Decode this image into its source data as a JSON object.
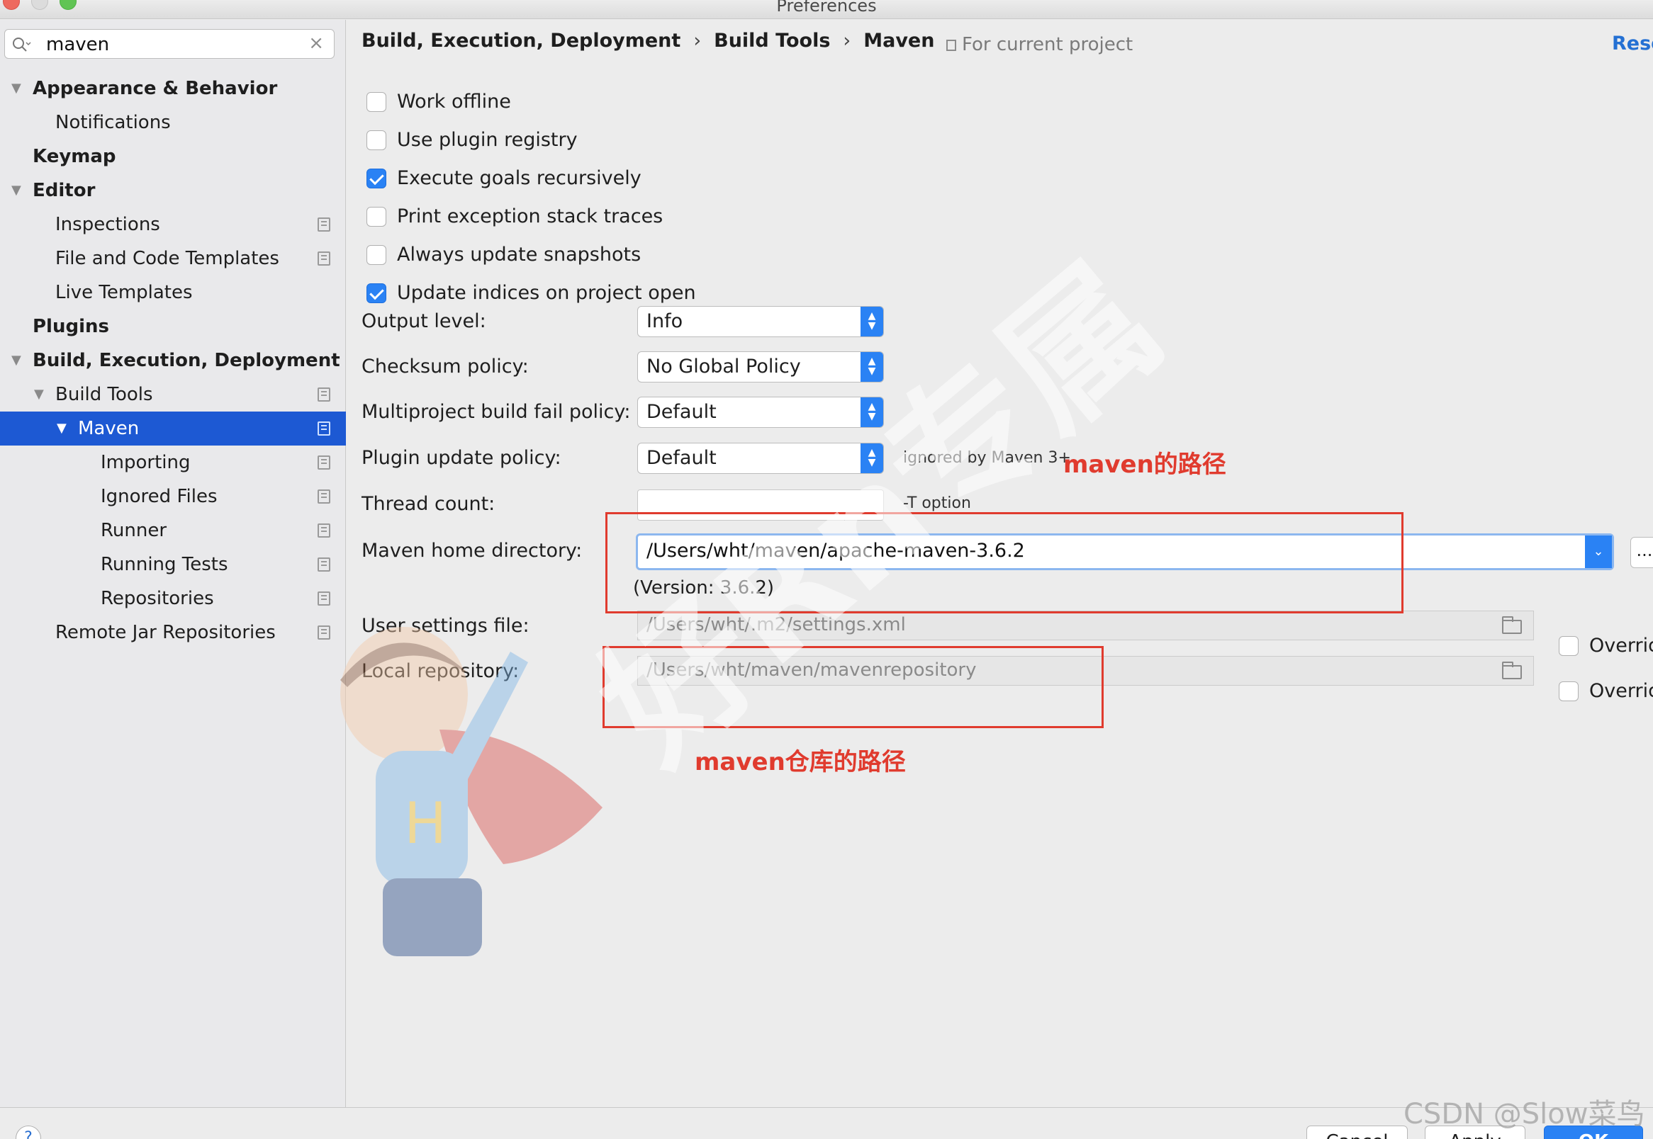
{
  "window": {
    "title": "Preferences"
  },
  "search": {
    "value": "maven",
    "clear_icon": "×"
  },
  "sidebar": {
    "items": [
      {
        "label": "Appearance & Behavior",
        "bold": true,
        "expanded": true,
        "indent": 0
      },
      {
        "label": "Notifications",
        "bold": false,
        "indent": 1
      },
      {
        "label": "Keymap",
        "bold": true,
        "indent": 0
      },
      {
        "label": "Editor",
        "bold": true,
        "expanded": true,
        "indent": 0
      },
      {
        "label": "Inspections",
        "indent": 1,
        "project_icon": true
      },
      {
        "label": "File and Code Templates",
        "indent": 1,
        "project_icon": true
      },
      {
        "label": "Live Templates",
        "indent": 1
      },
      {
        "label": "Plugins",
        "bold": true,
        "indent": 0
      },
      {
        "label": "Build, Execution, Deployment",
        "bold": true,
        "expanded": true,
        "indent": 0
      },
      {
        "label": "Build Tools",
        "indent": 1,
        "expanded": true,
        "project_icon": true
      },
      {
        "label": "Maven",
        "indent": 2,
        "expanded": true,
        "selected": true,
        "project_icon": true
      },
      {
        "label": "Importing",
        "indent": 3,
        "project_icon": true
      },
      {
        "label": "Ignored Files",
        "indent": 3,
        "project_icon": true
      },
      {
        "label": "Runner",
        "indent": 3,
        "project_icon": true
      },
      {
        "label": "Running Tests",
        "indent": 3,
        "project_icon": true
      },
      {
        "label": "Repositories",
        "indent": 3,
        "project_icon": true
      },
      {
        "label": "Remote Jar Repositories",
        "indent": 1,
        "project_icon": true
      }
    ]
  },
  "header": {
    "breadcrumb": [
      "Build, Execution, Deployment",
      "Build Tools",
      "Maven"
    ],
    "separator": "›",
    "for_project": "For current project",
    "reset": "Rese"
  },
  "options": [
    {
      "label": "Work offline",
      "checked": false
    },
    {
      "label": "Use plugin registry",
      "checked": false
    },
    {
      "label": "Execute goals recursively",
      "checked": true
    },
    {
      "label": "Print exception stack traces",
      "checked": false
    },
    {
      "label": "Always update snapshots",
      "checked": false
    },
    {
      "label": "Update indices on project open",
      "checked": true
    }
  ],
  "form": {
    "output_level": {
      "label": "Output level:",
      "value": "Info"
    },
    "checksum_policy": {
      "label": "Checksum policy:",
      "value": "No Global Policy"
    },
    "multiproject_policy": {
      "label": "Multiproject build fail policy:",
      "value": "Default"
    },
    "plugin_update_policy": {
      "label": "Plugin update policy:",
      "value": "Default",
      "note": "ignored by Maven 3+"
    },
    "thread_count": {
      "label": "Thread count:",
      "value": "",
      "note": "-T option"
    },
    "maven_home": {
      "label": "Maven home directory:",
      "value": "/Users/wht/maven/apache-maven-3.6.2",
      "version": "(Version: 3.6.2)",
      "browse": "..."
    },
    "user_settings": {
      "label": "User settings file:",
      "value": "/Users/wht/.m2/settings.xml",
      "override": "Overrid"
    },
    "local_repo": {
      "label": "Local repository:",
      "value": "/Users/wht/maven/mavenrepository",
      "override": "Overrid"
    }
  },
  "annotations": {
    "maven_path": "maven的路径",
    "repo_path": "maven仓库的路径"
  },
  "footer": {
    "help": "?",
    "cancel": "Cancel",
    "apply": "Apply",
    "ok": "OK"
  },
  "watermark": {
    "csdn": "CSDN @Slow菜鸟",
    "big": "好Rn专属"
  },
  "colors": {
    "accent": "#2a82f4",
    "selection": "#1d59d3",
    "annotation": "#e03b2e",
    "link": "#2470d3"
  }
}
